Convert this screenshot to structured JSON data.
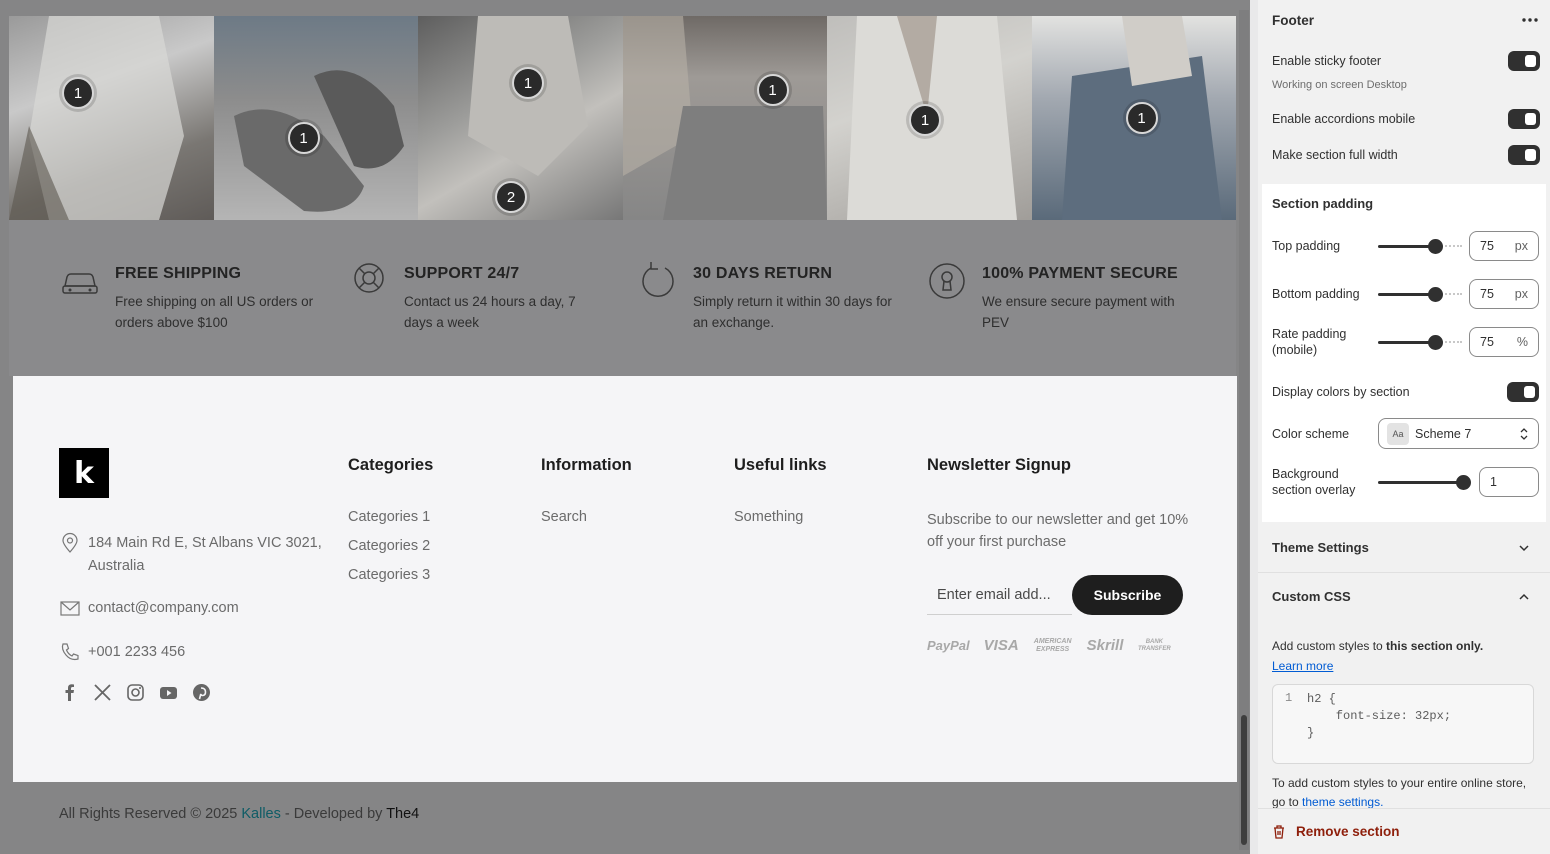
{
  "gallery": {
    "hotspots": [
      "1",
      "1",
      "1",
      "2",
      "1",
      "1",
      "1"
    ]
  },
  "features": [
    {
      "icon": "car-icon",
      "title": "FREE SHIPPING",
      "text": "Free shipping on all US orders or orders above $100"
    },
    {
      "icon": "lifebuoy-icon",
      "title": "SUPPORT 24/7",
      "text": "Contact us 24 hours a day, 7 days a week"
    },
    {
      "icon": "return-arrow-icon",
      "title": "30 DAYS RETURN",
      "text": "Simply return it within 30 days for an exchange."
    },
    {
      "icon": "keyhole-icon",
      "title": "100% PAYMENT SECURE",
      "text": "We ensure secure payment with PEV"
    }
  ],
  "footer": {
    "logo_letter": "k",
    "address": "184 Main Rd E, St Albans VIC 3021, Australia",
    "email": "contact@company.com",
    "phone": "+001 2233 456",
    "columns": [
      {
        "title": "Categories",
        "links": [
          "Categories 1",
          "Categories 2",
          "Categories 3"
        ]
      },
      {
        "title": "Information",
        "links": [
          "Search"
        ]
      },
      {
        "title": "Useful links",
        "links": [
          "Something"
        ]
      }
    ],
    "newsletter": {
      "title": "Newsletter Signup",
      "text": "Subscribe to our newsletter and get 10% off your first purchase",
      "placeholder": "Enter email add...",
      "button": "Subscribe"
    },
    "payments": [
      "PayPal",
      "VISA",
      "AMERICAN EXPRESS",
      "Skrill",
      "BANK TRANSFER"
    ],
    "copyright_prefix": "All Rights Reserved © 2025 ",
    "copyright_brand": "Kalles",
    "copyright_mid": " - Developed by ",
    "copyright_dev": "The4"
  },
  "panel": {
    "title": "Footer",
    "sticky_label": "Enable sticky footer",
    "sticky_sub": "Working on screen Desktop",
    "accordion_label": "Enable accordions mobile",
    "fullwidth_label": "Make section full width",
    "padding_title": "Section padding",
    "top_label": "Top padding",
    "top_value": "75",
    "top_unit": "px",
    "bottom_label": "Bottom padding",
    "bottom_value": "75",
    "bottom_unit": "px",
    "rate_label": "Rate padding (mobile)",
    "rate_value": "75",
    "rate_unit": "%",
    "display_colors_label": "Display colors by section",
    "scheme_label": "Color scheme",
    "scheme_swatch": "Aa",
    "scheme_value": "Scheme 7",
    "overlay_label": "Background section overlay",
    "overlay_value": "1",
    "theme_settings": "Theme Settings",
    "custom_css": "Custom CSS",
    "css_help_prefix": "Add custom styles to ",
    "css_help_bold": "this section only.",
    "learn_more": "Learn more",
    "code_line_numbers": "1",
    "code": "h2 {\n    font-size: 32px;\n}",
    "css_note_prefix": "To add custom styles to your entire online store, go to ",
    "css_note_link": "theme settings.",
    "remove": "Remove section"
  },
  "colors": {
    "accent": "#303030",
    "brand_link": "#0f5c66",
    "danger": "#8e1f0b",
    "link": "#005bd3"
  }
}
